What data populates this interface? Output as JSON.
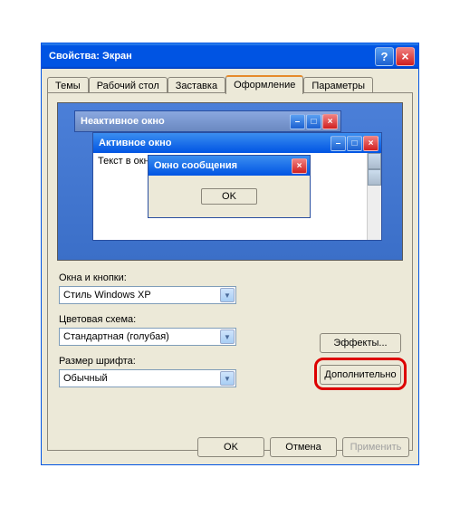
{
  "window": {
    "title": "Свойства: Экран",
    "help": "?",
    "close": "×"
  },
  "tabs": {
    "items": [
      {
        "label": "Темы"
      },
      {
        "label": "Рабочий стол"
      },
      {
        "label": "Заставка"
      },
      {
        "label": "Оформление"
      },
      {
        "label": "Параметры"
      }
    ],
    "active": 3
  },
  "preview": {
    "inactive": {
      "title": "Неактивное окно"
    },
    "active": {
      "title": "Активное окно",
      "body_text": "Текст в окне"
    },
    "msgbox": {
      "title": "Окно сообщения",
      "ok": "OK"
    }
  },
  "controls": {
    "windows_label": "Окна и кнопки:",
    "windows_value": "Стиль Windows XP",
    "color_label": "Цветовая схема:",
    "color_value": "Стандартная (голубая)",
    "font_label": "Размер шрифта:",
    "font_value": "Обычный",
    "effects": "Эффекты...",
    "advanced": "Дополнительно"
  },
  "buttons": {
    "ok": "OK",
    "cancel": "Отмена",
    "apply": "Применить"
  }
}
